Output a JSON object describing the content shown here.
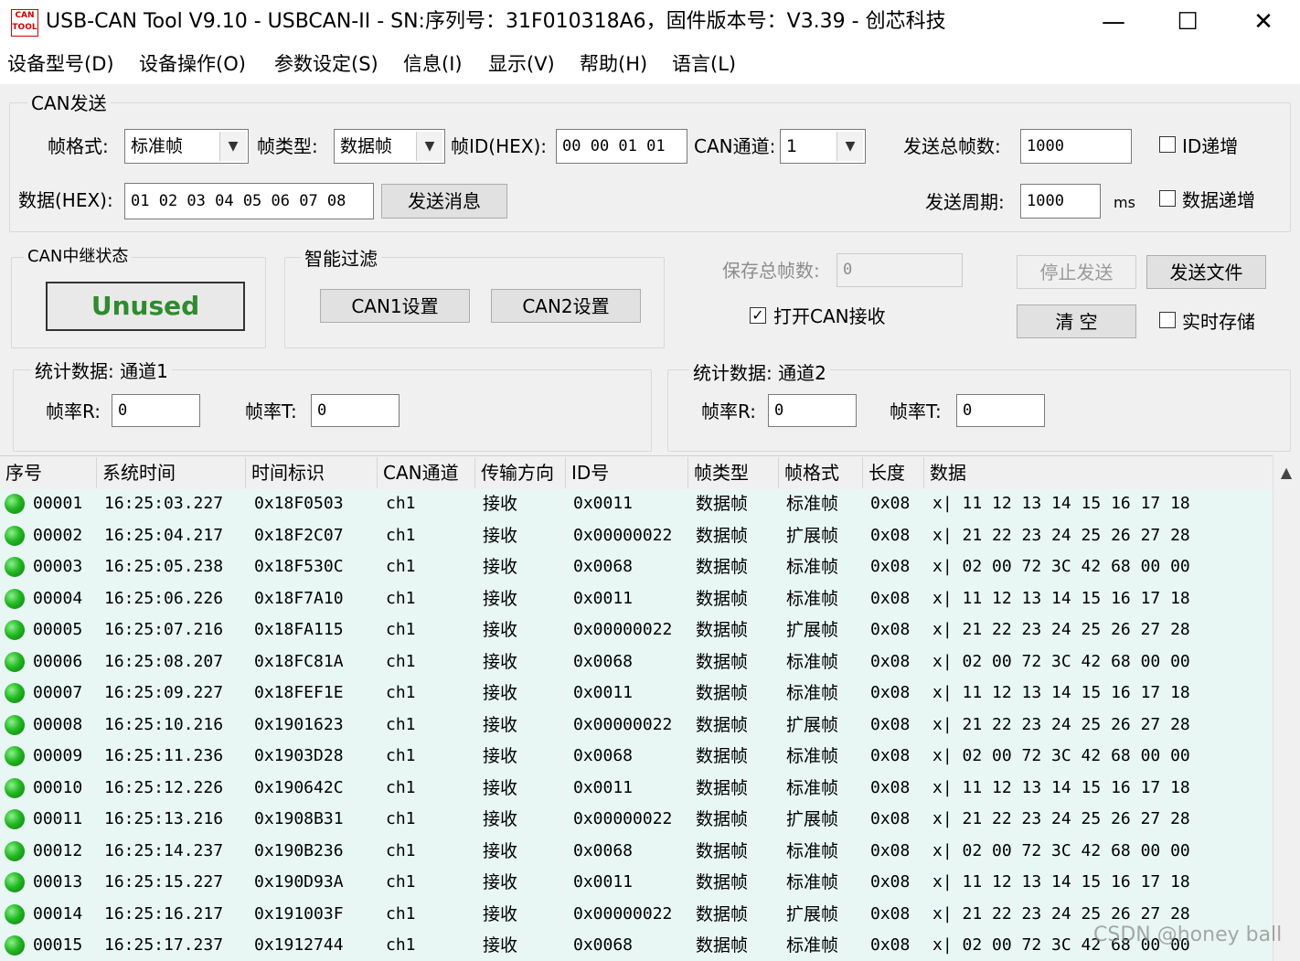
{
  "window": {
    "icon_text": "CAN TOOL",
    "title": "USB-CAN Tool V9.10 - USBCAN-II - SN:序列号：31F010318A6，固件版本号：V3.39 - 创芯科技",
    "minimize": "—",
    "maximize": "☐",
    "close": "✕"
  },
  "menu": [
    "设备型号(D)",
    "设备操作(O)",
    "参数设定(S)",
    "信息(I)",
    "显示(V)",
    "帮助(H)",
    "语言(L)"
  ],
  "can_send": {
    "legend": "CAN发送",
    "frame_format_label": "帧格式:",
    "frame_format_value": "标准帧",
    "frame_type_label": "帧类型:",
    "frame_type_value": "数据帧",
    "frame_id_label": "帧ID(HEX):",
    "frame_id_value": "00 00 01 01",
    "channel_label": "CAN通道:",
    "channel_value": "1",
    "total_frames_label": "发送总帧数:",
    "total_frames_value": "1000",
    "id_increment_label": "ID递增",
    "data_label": "数据(HEX):",
    "data_value": "01 02 03 04 05 06 07 08",
    "send_button": "发送消息",
    "period_label": "发送周期:",
    "period_value": "1000",
    "period_unit": "ms",
    "data_increment_label": "数据递增"
  },
  "relay": {
    "legend": "CAN中继状态",
    "status_button": "Unused"
  },
  "filter": {
    "legend": "智能过滤",
    "can1_button": "CAN1设置",
    "can2_button": "CAN2设置"
  },
  "controls": {
    "save_total_label": "保存总帧数:",
    "save_total_value": "0",
    "stop_send_button": "停止发送",
    "send_file_button": "发送文件",
    "open_receive_label": "打开CAN接收",
    "open_receive_checked": "✓",
    "clear_button": "清 空",
    "realtime_save_label": "实时存储"
  },
  "stats1": {
    "legend": "统计数据: 通道1",
    "rate_r_label": "帧率R:",
    "rate_r_value": "0",
    "rate_t_label": "帧率T:",
    "rate_t_value": "0"
  },
  "stats2": {
    "legend": "统计数据: 通道2",
    "rate_r_label": "帧率R:",
    "rate_r_value": "0",
    "rate_t_label": "帧率T:",
    "rate_t_value": "0"
  },
  "table": {
    "headers": [
      "序号",
      "系统时间",
      "时间标识",
      "CAN通道",
      "传输方向",
      "ID号",
      "帧类型",
      "帧格式",
      "长度",
      "数据"
    ],
    "rows": [
      [
        "00001",
        "16:25:03.227",
        "0x18F0503",
        "ch1",
        "接收",
        "0x0011",
        "数据帧",
        "标准帧",
        "0x08",
        "x| 11 12 13 14 15 16 17 18"
      ],
      [
        "00002",
        "16:25:04.217",
        "0x18F2C07",
        "ch1",
        "接收",
        "0x00000022",
        "数据帧",
        "扩展帧",
        "0x08",
        "x| 21 22 23 24 25 26 27 28"
      ],
      [
        "00003",
        "16:25:05.238",
        "0x18F530C",
        "ch1",
        "接收",
        "0x0068",
        "数据帧",
        "标准帧",
        "0x08",
        "x| 02 00 72 3C 42 68 00 00"
      ],
      [
        "00004",
        "16:25:06.226",
        "0x18F7A10",
        "ch1",
        "接收",
        "0x0011",
        "数据帧",
        "标准帧",
        "0x08",
        "x| 11 12 13 14 15 16 17 18"
      ],
      [
        "00005",
        "16:25:07.216",
        "0x18FA115",
        "ch1",
        "接收",
        "0x00000022",
        "数据帧",
        "扩展帧",
        "0x08",
        "x| 21 22 23 24 25 26 27 28"
      ],
      [
        "00006",
        "16:25:08.207",
        "0x18FC81A",
        "ch1",
        "接收",
        "0x0068",
        "数据帧",
        "标准帧",
        "0x08",
        "x| 02 00 72 3C 42 68 00 00"
      ],
      [
        "00007",
        "16:25:09.227",
        "0x18FEF1E",
        "ch1",
        "接收",
        "0x0011",
        "数据帧",
        "标准帧",
        "0x08",
        "x| 11 12 13 14 15 16 17 18"
      ],
      [
        "00008",
        "16:25:10.216",
        "0x1901623",
        "ch1",
        "接收",
        "0x00000022",
        "数据帧",
        "扩展帧",
        "0x08",
        "x| 21 22 23 24 25 26 27 28"
      ],
      [
        "00009",
        "16:25:11.236",
        "0x1903D28",
        "ch1",
        "接收",
        "0x0068",
        "数据帧",
        "标准帧",
        "0x08",
        "x| 02 00 72 3C 42 68 00 00"
      ],
      [
        "00010",
        "16:25:12.226",
        "0x190642C",
        "ch1",
        "接收",
        "0x0011",
        "数据帧",
        "标准帧",
        "0x08",
        "x| 11 12 13 14 15 16 17 18"
      ],
      [
        "00011",
        "16:25:13.216",
        "0x1908B31",
        "ch1",
        "接收",
        "0x00000022",
        "数据帧",
        "扩展帧",
        "0x08",
        "x| 21 22 23 24 25 26 27 28"
      ],
      [
        "00012",
        "16:25:14.237",
        "0x190B236",
        "ch1",
        "接收",
        "0x0068",
        "数据帧",
        "标准帧",
        "0x08",
        "x| 02 00 72 3C 42 68 00 00"
      ],
      [
        "00013",
        "16:25:15.227",
        "0x190D93A",
        "ch1",
        "接收",
        "0x0011",
        "数据帧",
        "标准帧",
        "0x08",
        "x| 11 12 13 14 15 16 17 18"
      ],
      [
        "00014",
        "16:25:16.217",
        "0x191003F",
        "ch1",
        "接收",
        "0x00000022",
        "数据帧",
        "扩展帧",
        "0x08",
        "x| 21 22 23 24 25 26 27 28"
      ],
      [
        "00015",
        "16:25:17.237",
        "0x1912744",
        "ch1",
        "接收",
        "0x0068",
        "数据帧",
        "标准帧",
        "0x08",
        "x| 02 00 72 3C 42 68 00 00"
      ]
    ],
    "scroll_up": "▲"
  },
  "watermark": "CSDN @honey ball"
}
